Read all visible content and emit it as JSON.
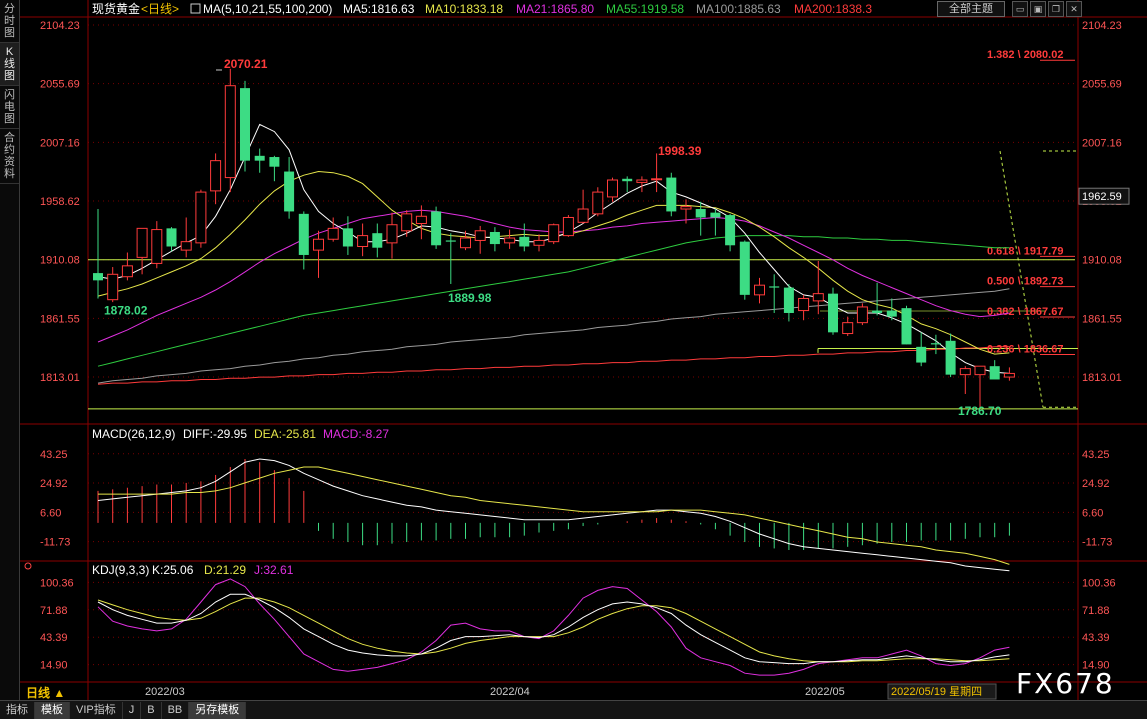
{
  "left_tabs": [
    {
      "label": "分时图",
      "active": false
    },
    {
      "label": "K线图",
      "active": true
    },
    {
      "label": "闪电图",
      "active": false
    },
    {
      "label": "合约资料",
      "active": false
    }
  ],
  "header": {
    "instrument": "现货黄金",
    "period_tag": "<日线>",
    "ma_title": "MA(5,10,21,55,100,200)",
    "ma5": "MA5:1816.63",
    "ma10": "MA10:1833.18",
    "ma21": "MA21:1865.80",
    "ma55": "MA55:1919.58",
    "ma100": "MA100:1885.63",
    "ma200": "MA200:1838.3",
    "theme_button": "全部主题"
  },
  "colors": {
    "up": "#ff3b3b",
    "down": "#3ddc84",
    "ma5": "#ffffff",
    "ma10": "#e6e64a",
    "ma21": "#e030e0",
    "ma55": "#2ecc40",
    "ma100": "#9a9a9a",
    "ma200": "#ff3b3b",
    "axis_label": "#ff5555",
    "grid": "#7a0000"
  },
  "main_axis": {
    "labels": [
      "2104.23",
      "2055.69",
      "2007.16",
      "1958.62",
      "1910.08",
      "1861.55",
      "1813.01"
    ],
    "current_price": "1962.59"
  },
  "annotations": {
    "high": "2070.21",
    "mid_high": "1998.39",
    "low1": "1878.02",
    "low2": "1889.98",
    "low3": "1786.70"
  },
  "fib": [
    {
      "label": "1.382 \\ 2080.02",
      "price": 2080.02
    },
    {
      "label": "0.618 \\ 1917.79",
      "price": 1917.79
    },
    {
      "label": "0.500 \\ 1892.73",
      "price": 1892.73
    },
    {
      "label": "0.382 \\ 1867.67",
      "price": 1867.67
    },
    {
      "label": "0.236 \\ 1836.67",
      "price": 1836.67
    }
  ],
  "macd": {
    "title": "MACD(26,12,9)",
    "diff": "DIFF:-29.95",
    "dea": "DEA:-25.81",
    "macd": "MACD:-8.27",
    "axis_labels": [
      "43.25",
      "24.92",
      "6.60",
      "-11.73"
    ]
  },
  "kdj": {
    "title": "KDJ(9,3,3)",
    "k": "K:25.06",
    "d": "D:21.29",
    "j": "J:32.61",
    "axis_labels": [
      "100.36",
      "71.88",
      "43.39",
      "14.90"
    ]
  },
  "date_axis": {
    "labels": [
      "2022/03",
      "2022/04",
      "2022/05"
    ],
    "cursor_date": "2022/05/19 星期四"
  },
  "period_selector": "日线 ▲",
  "bottom_tabs": [
    {
      "label": "指标",
      "selected": false
    },
    {
      "label": "模板",
      "selected": true
    },
    {
      "label": "VIP指标",
      "selected": false
    },
    {
      "label": "J",
      "selected": false
    },
    {
      "label": "B",
      "selected": false
    },
    {
      "label": "BB",
      "selected": false
    },
    {
      "label": "另存模板",
      "selected": true
    }
  ],
  "watermark": "FX678",
  "chart_data": {
    "type": "candlestick",
    "price_axis": {
      "min": 1775,
      "max": 2110
    },
    "candles": [
      {
        "o": 1899,
        "h": 1952,
        "l": 1878,
        "c": 1893
      },
      {
        "o": 1877,
        "h": 1904,
        "l": 1875,
        "c": 1898
      },
      {
        "o": 1896,
        "h": 1916,
        "l": 1893,
        "c": 1905
      },
      {
        "o": 1912,
        "h": 1934,
        "l": 1898,
        "c": 1936
      },
      {
        "o": 1907,
        "h": 1942,
        "l": 1903,
        "c": 1935
      },
      {
        "o": 1936,
        "h": 1937,
        "l": 1917,
        "c": 1921
      },
      {
        "o": 1918,
        "h": 1945,
        "l": 1912,
        "c": 1925
      },
      {
        "o": 1924,
        "h": 1968,
        "l": 1920,
        "c": 1966
      },
      {
        "o": 1967,
        "h": 1998,
        "l": 1956,
        "c": 1992
      },
      {
        "o": 1978,
        "h": 2068,
        "l": 1966,
        "c": 2054
      },
      {
        "o": 2052,
        "h": 2058,
        "l": 1983,
        "c": 1992
      },
      {
        "o": 1996,
        "h": 2002,
        "l": 1982,
        "c": 1992
      },
      {
        "o": 1995,
        "h": 1996,
        "l": 1975,
        "c": 1987
      },
      {
        "o": 1983,
        "h": 1995,
        "l": 1944,
        "c": 1950
      },
      {
        "o": 1948,
        "h": 1950,
        "l": 1902,
        "c": 1914
      },
      {
        "o": 1918,
        "h": 1934,
        "l": 1895,
        "c": 1927
      },
      {
        "o": 1927,
        "h": 1945,
        "l": 1925,
        "c": 1936
      },
      {
        "o": 1936,
        "h": 1946,
        "l": 1914,
        "c": 1921
      },
      {
        "o": 1921,
        "h": 1940,
        "l": 1913,
        "c": 1930
      },
      {
        "o": 1932,
        "h": 1940,
        "l": 1912,
        "c": 1920
      },
      {
        "o": 1924,
        "h": 1949,
        "l": 1911,
        "c": 1939
      },
      {
        "o": 1934,
        "h": 1951,
        "l": 1929,
        "c": 1948
      },
      {
        "o": 1940,
        "h": 1955,
        "l": 1927,
        "c": 1946
      },
      {
        "o": 1950,
        "h": 1954,
        "l": 1919,
        "c": 1922
      },
      {
        "o": 1926,
        "h": 1932,
        "l": 1890,
        "c": 1925
      },
      {
        "o": 1920,
        "h": 1934,
        "l": 1918,
        "c": 1928
      },
      {
        "o": 1926,
        "h": 1938,
        "l": 1915,
        "c": 1934
      },
      {
        "o": 1933,
        "h": 1937,
        "l": 1917,
        "c": 1923
      },
      {
        "o": 1924,
        "h": 1935,
        "l": 1919,
        "c": 1928
      },
      {
        "o": 1929,
        "h": 1940,
        "l": 1917,
        "c": 1921
      },
      {
        "o": 1922,
        "h": 1931,
        "l": 1917,
        "c": 1926
      },
      {
        "o": 1925,
        "h": 1940,
        "l": 1923,
        "c": 1939
      },
      {
        "o": 1930,
        "h": 1947,
        "l": 1929,
        "c": 1945
      },
      {
        "o": 1941,
        "h": 1968,
        "l": 1940,
        "c": 1952
      },
      {
        "o": 1948,
        "h": 1970,
        "l": 1946,
        "c": 1966
      },
      {
        "o": 1962,
        "h": 1978,
        "l": 1958,
        "c": 1976
      },
      {
        "o": 1977,
        "h": 1979,
        "l": 1966,
        "c": 1975
      },
      {
        "o": 1974,
        "h": 1979,
        "l": 1966,
        "c": 1976
      },
      {
        "o": 1977,
        "h": 1998,
        "l": 1966,
        "c": 1977
      },
      {
        "o": 1978,
        "h": 1982,
        "l": 1946,
        "c": 1950
      },
      {
        "o": 1952,
        "h": 1960,
        "l": 1940,
        "c": 1954
      },
      {
        "o": 1952,
        "h": 1958,
        "l": 1930,
        "c": 1945
      },
      {
        "o": 1949,
        "h": 1952,
        "l": 1930,
        "c": 1945
      },
      {
        "o": 1947,
        "h": 1948,
        "l": 1917,
        "c": 1922
      },
      {
        "o": 1925,
        "h": 1926,
        "l": 1877,
        "c": 1881
      },
      {
        "o": 1881,
        "h": 1895,
        "l": 1874,
        "c": 1889
      },
      {
        "o": 1888,
        "h": 1898,
        "l": 1866,
        "c": 1887
      },
      {
        "o": 1887,
        "h": 1890,
        "l": 1859,
        "c": 1866
      },
      {
        "o": 1868,
        "h": 1881,
        "l": 1860,
        "c": 1878
      },
      {
        "o": 1876,
        "h": 1909,
        "l": 1865,
        "c": 1882
      },
      {
        "o": 1882,
        "h": 1887,
        "l": 1848,
        "c": 1850
      },
      {
        "o": 1849,
        "h": 1863,
        "l": 1847,
        "c": 1858
      },
      {
        "o": 1858,
        "h": 1874,
        "l": 1856,
        "c": 1871
      },
      {
        "o": 1868,
        "h": 1891,
        "l": 1864,
        "c": 1866
      },
      {
        "o": 1868,
        "h": 1878,
        "l": 1860,
        "c": 1863
      },
      {
        "o": 1870,
        "h": 1872,
        "l": 1840,
        "c": 1840
      },
      {
        "o": 1838,
        "h": 1850,
        "l": 1822,
        "c": 1825
      },
      {
        "o": 1841,
        "h": 1848,
        "l": 1832,
        "c": 1840
      },
      {
        "o": 1843,
        "h": 1849,
        "l": 1813,
        "c": 1815
      },
      {
        "o": 1815,
        "h": 1822,
        "l": 1799,
        "c": 1820
      },
      {
        "o": 1815,
        "h": 1822,
        "l": 1787,
        "c": 1822
      },
      {
        "o": 1822,
        "h": 1827,
        "l": 1812,
        "c": 1811
      },
      {
        "o": 1813,
        "h": 1821,
        "l": 1810,
        "c": 1816
      }
    ],
    "ma_lines": {
      "ma5": [
        1896,
        1894,
        1897,
        1903,
        1910,
        1917,
        1924,
        1930,
        1946,
        1968,
        1995,
        2022,
        2016,
        2001,
        1968,
        1950,
        1940,
        1933,
        1925,
        1925,
        1927,
        1932,
        1938,
        1937,
        1934,
        1932,
        1929,
        1928,
        1927,
        1925,
        1925,
        1928,
        1933,
        1940,
        1949,
        1957,
        1965,
        1971,
        1975,
        1966,
        1962,
        1957,
        1952,
        1945,
        1932,
        1916,
        1902,
        1888,
        1881,
        1879,
        1872,
        1866,
        1866,
        1866,
        1862,
        1857,
        1850,
        1843,
        1833,
        1825,
        1820,
        1817,
        1816
      ],
      "ma10": [
        1880,
        1883,
        1886,
        1890,
        1895,
        1900,
        1905,
        1911,
        1920,
        1931,
        1943,
        1956,
        1967,
        1975,
        1980,
        1983,
        1982,
        1979,
        1973,
        1962,
        1951,
        1943,
        1936,
        1932,
        1930,
        1929,
        1928,
        1929,
        1930,
        1931,
        1930,
        1930,
        1931,
        1934,
        1938,
        1942,
        1947,
        1951,
        1955,
        1955,
        1955,
        1954,
        1953,
        1949,
        1944,
        1937,
        1929,
        1920,
        1912,
        1903,
        1893,
        1884,
        1877,
        1873,
        1870,
        1864,
        1857,
        1853,
        1848,
        1842,
        1836,
        1832,
        1833
      ],
      "ma21": [
        1842,
        1847,
        1852,
        1858,
        1864,
        1869,
        1874,
        1879,
        1885,
        1892,
        1900,
        1908,
        1915,
        1921,
        1927,
        1932,
        1936,
        1940,
        1944,
        1946,
        1948,
        1950,
        1951,
        1950,
        1948,
        1946,
        1943,
        1940,
        1937,
        1935,
        1934,
        1933,
        1933,
        1934,
        1935,
        1937,
        1938,
        1940,
        1941,
        1942,
        1943,
        1944,
        1945,
        1944,
        1942,
        1938,
        1933,
        1928,
        1922,
        1916,
        1910,
        1903,
        1897,
        1892,
        1887,
        1882,
        1877,
        1872,
        1868,
        1865,
        1863,
        1864,
        1866
      ],
      "ma55": [
        1822,
        1825,
        1828,
        1831,
        1834,
        1837,
        1840,
        1843,
        1846,
        1849,
        1852,
        1855,
        1858,
        1861,
        1864,
        1866,
        1868,
        1870,
        1872,
        1874,
        1876,
        1878,
        1880,
        1882,
        1884,
        1886,
        1888,
        1890,
        1892,
        1894,
        1896,
        1898,
        1900,
        1903,
        1906,
        1909,
        1912,
        1915,
        1918,
        1921,
        1924,
        1926,
        1928,
        1929,
        1930,
        1930,
        1930,
        1930,
        1929,
        1929,
        1928,
        1928,
        1927,
        1927,
        1926,
        1926,
        1925,
        1924,
        1923,
        1922,
        1921,
        1920,
        1920
      ],
      "ma100": [
        1808,
        1810,
        1811,
        1812,
        1814,
        1815,
        1816,
        1818,
        1819,
        1820,
        1822,
        1823,
        1825,
        1826,
        1828,
        1829,
        1831,
        1832,
        1834,
        1835,
        1836,
        1838,
        1839,
        1840,
        1842,
        1843,
        1844,
        1845,
        1846,
        1848,
        1849,
        1850,
        1851,
        1852,
        1854,
        1855,
        1856,
        1858,
        1859,
        1861,
        1862,
        1863,
        1865,
        1866,
        1867,
        1868,
        1869,
        1870,
        1871,
        1872,
        1873,
        1874,
        1875,
        1876,
        1877,
        1878,
        1879,
        1880,
        1881,
        1882,
        1883,
        1884,
        1886
      ],
      "ma200": [
        1807,
        1808,
        1808,
        1809,
        1809,
        1810,
        1810,
        1811,
        1811,
        1812,
        1812,
        1813,
        1813,
        1814,
        1814,
        1815,
        1815,
        1816,
        1816,
        1817,
        1817,
        1818,
        1818,
        1819,
        1819,
        1820,
        1820,
        1821,
        1821,
        1822,
        1822,
        1823,
        1823,
        1824,
        1824,
        1825,
        1825,
        1826,
        1826,
        1827,
        1827,
        1828,
        1828,
        1829,
        1829,
        1830,
        1830,
        1831,
        1831,
        1832,
        1832,
        1833,
        1833,
        1834,
        1834,
        1835,
        1835,
        1836,
        1836,
        1837,
        1837,
        1838,
        1838
      ]
    },
    "macd_axis": {
      "min": -22,
      "max": 50
    },
    "macd_hist": [
      20,
      21,
      22,
      23,
      24,
      24,
      25,
      26,
      30,
      35,
      40,
      38,
      33,
      28,
      20,
      -5,
      -10,
      -12,
      -14,
      -14,
      -13,
      -12,
      -11,
      -11,
      -10,
      -10,
      -9,
      -9,
      -9,
      -8,
      -6,
      -5,
      -4,
      -2,
      -1,
      0,
      1,
      2,
      3,
      2,
      1,
      -1,
      -4,
      -8,
      -12,
      -15,
      -16,
      -17,
      -17,
      -16,
      -16,
      -15,
      -14,
      -13,
      -12,
      -12,
      -11,
      -11,
      -11,
      -10,
      -9,
      -9,
      -8
    ],
    "macd_diff": [
      14,
      15,
      16,
      17,
      18,
      19,
      20,
      22,
      26,
      32,
      38,
      40,
      39,
      36,
      31,
      27,
      23,
      20,
      17,
      15,
      13,
      11,
      10,
      8,
      7,
      6,
      5,
      4,
      3,
      2,
      2,
      2,
      2,
      3,
      4,
      5,
      6,
      7,
      8,
      8,
      7,
      6,
      4,
      1,
      -3,
      -7,
      -10,
      -13,
      -15,
      -16,
      -17,
      -18,
      -19,
      -20,
      -21,
      -22,
      -23,
      -24,
      -25,
      -27,
      -28,
      -29,
      -30
    ],
    "macd_dea": [
      18,
      18,
      18,
      18,
      18,
      18,
      19,
      19,
      20,
      22,
      25,
      28,
      31,
      33,
      35,
      35,
      33,
      31,
      29,
      27,
      25,
      23,
      21,
      19,
      17,
      16,
      14,
      13,
      12,
      11,
      10,
      9,
      8,
      7,
      7,
      7,
      7,
      7,
      7,
      8,
      8,
      8,
      7,
      6,
      5,
      3,
      1,
      -1,
      -3,
      -5,
      -7,
      -9,
      -10,
      -12,
      -13,
      -14,
      -15,
      -17,
      -18,
      -19,
      -21,
      -23,
      -26
    ],
    "kdj_axis": {
      "min": 0,
      "max": 108
    },
    "kdj_k": [
      80,
      72,
      66,
      62,
      58,
      58,
      61,
      68,
      80,
      88,
      88,
      82,
      74,
      64,
      52,
      44,
      36,
      30,
      27,
      25,
      24,
      24,
      26,
      32,
      40,
      44,
      44,
      45,
      46,
      44,
      43,
      46,
      54,
      64,
      72,
      78,
      80,
      78,
      74,
      68,
      56,
      46,
      38,
      30,
      22,
      18,
      17,
      16,
      16,
      18,
      18,
      19,
      20,
      20,
      22,
      24,
      22,
      20,
      18,
      18,
      20,
      23,
      25
    ],
    "kdj_d": [
      82,
      77,
      72,
      68,
      64,
      62,
      61,
      63,
      70,
      78,
      84,
      84,
      80,
      74,
      66,
      58,
      50,
      42,
      36,
      32,
      29,
      27,
      26,
      28,
      32,
      37,
      40,
      42,
      44,
      44,
      44,
      44,
      48,
      54,
      62,
      68,
      73,
      76,
      76,
      74,
      68,
      60,
      52,
      44,
      36,
      28,
      24,
      21,
      19,
      18,
      18,
      18,
      19,
      19,
      20,
      21,
      21,
      21,
      20,
      19,
      19,
      20,
      21
    ],
    "kdj_j": [
      75,
      60,
      55,
      52,
      50,
      52,
      62,
      80,
      98,
      104,
      96,
      78,
      62,
      44,
      26,
      18,
      10,
      8,
      10,
      12,
      16,
      20,
      28,
      40,
      56,
      58,
      52,
      50,
      50,
      44,
      42,
      50,
      66,
      84,
      92,
      96,
      94,
      82,
      70,
      54,
      32,
      22,
      18,
      14,
      6,
      4,
      4,
      6,
      10,
      16,
      18,
      20,
      22,
      22,
      26,
      30,
      24,
      16,
      14,
      16,
      22,
      30,
      33
    ]
  }
}
